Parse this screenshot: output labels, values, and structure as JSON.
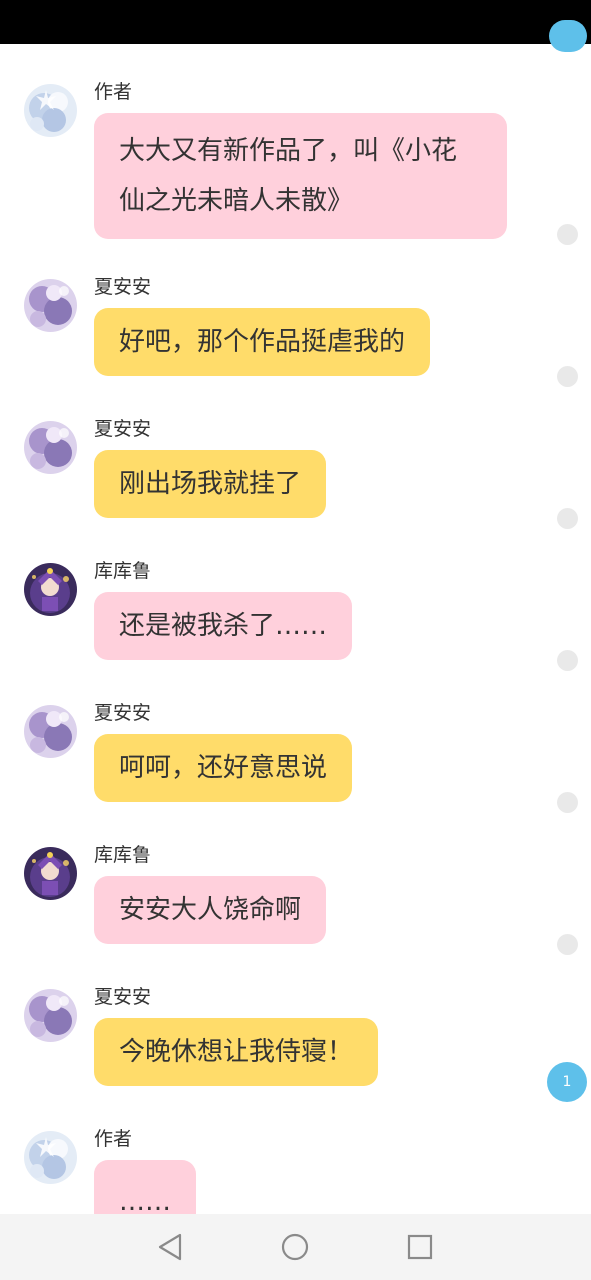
{
  "colors": {
    "bubble_pink": "#ffd0dc",
    "bubble_yellow": "#ffdc6a",
    "accent_blue": "#5ec0ea",
    "status_bar": "#000000",
    "nav_bar": "#f4f4f4"
  },
  "messages": [
    {
      "sender": "作者",
      "text": "大大又有新作品了，叫《小花仙之光未暗人未散》",
      "avatar": "author-avatar",
      "bubble_color": "pink"
    },
    {
      "sender": "夏安安",
      "text": "好吧，那个作品挺虐我的",
      "avatar": "xiaanan-avatar",
      "bubble_color": "yellow"
    },
    {
      "sender": "夏安安",
      "text": "刚出场我就挂了",
      "avatar": "xiaanan-avatar",
      "bubble_color": "yellow"
    },
    {
      "sender": "库库鲁",
      "text": "还是被我杀了……",
      "avatar": "kukulu-avatar",
      "bubble_color": "pink"
    },
    {
      "sender": "夏安安",
      "text": "呵呵，还好意思说",
      "avatar": "xiaanan-avatar",
      "bubble_color": "yellow"
    },
    {
      "sender": "库库鲁",
      "text": "安安大人饶命啊",
      "avatar": "kukulu-avatar",
      "bubble_color": "pink"
    },
    {
      "sender": "夏安安",
      "text": "今晚休想让我侍寝！",
      "avatar": "xiaanan-avatar",
      "bubble_color": "yellow"
    },
    {
      "sender": "作者",
      "text": "……",
      "avatar": "author-avatar",
      "bubble_color": "pink"
    }
  ],
  "unread_badge": {
    "count": "1"
  },
  "nav_bar": {
    "back_icon": "triangle-back-icon",
    "home_icon": "circle-home-icon",
    "recents_icon": "square-recents-icon"
  }
}
